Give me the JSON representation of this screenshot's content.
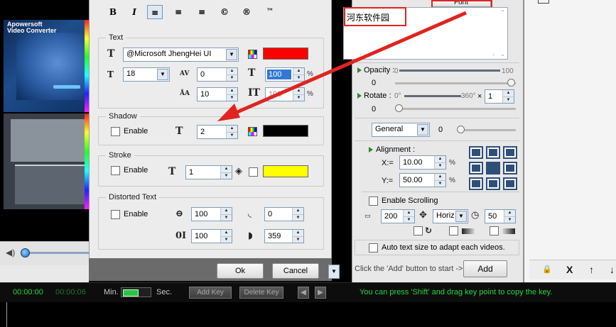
{
  "preview": {
    "brand_line1": "Apowersoft",
    "brand_line2": "Video Converter"
  },
  "dialog": {
    "toolbar": [
      "B",
      "I",
      "≡",
      "≡",
      "≡",
      "©",
      "®",
      "™"
    ],
    "text": {
      "title": "Text",
      "font": "@Microsoft JhengHei UI",
      "size": "18",
      "spacing": "0",
      "scale": "100",
      "line_height": "10",
      "opacity": "100",
      "color": "#ff0000",
      "pct": "%"
    },
    "shadow": {
      "title": "Shadow",
      "enable_label": "Enable",
      "value": "2",
      "color": "#000000"
    },
    "stroke": {
      "title": "Stroke",
      "enable_label": "Enable",
      "value": "1",
      "color": "#ffff00"
    },
    "distorted": {
      "title": "Distorted Text",
      "enable_label": "Enable",
      "width": "100",
      "height": "100",
      "angle1": "0",
      "angle2": "359"
    },
    "ok_label": "Ok",
    "cancel_label": "Cancel"
  },
  "watermark": {
    "tab_label": "Font",
    "text_content": "河东软件园",
    "opacity_label": "Opacity :",
    "opacity_min": "0",
    "opacity_max": "100",
    "opacity_value": "0",
    "rotate_label": "Rotate :",
    "rotate_min": "0°",
    "rotate_max": "360°",
    "rotate_mult": "×",
    "rotate_multiplier": "1",
    "rotate_value": "0",
    "mode_select": "General",
    "mode_value": "0",
    "alignment_label": "Alignment :",
    "x_label": "X:=",
    "x_value": "10.00",
    "y_label": "Y:=",
    "y_value": "50.00",
    "pct": "%",
    "scroll_label": "Enable Scrolling",
    "scroll_value": "200",
    "scroll_dir": "Horiz",
    "scroll_speed": "50",
    "auto_size_label": "Auto text size to adapt each videos.",
    "hint": "Click the 'Add' button to start ->",
    "add_label": "Add"
  },
  "right_tools": {
    "lock": "🔒",
    "delete": "X",
    "up": "↑",
    "down": "↓"
  },
  "timebar": {
    "current": "00:00:00",
    "total": "00:00:06",
    "min_label": "Min.",
    "sec_label": "Sec.",
    "add_key": "Add Key",
    "delete_key": "Delete Key",
    "hint": "You can press 'Shift' and drag key point to copy the key."
  },
  "colors": {
    "accent_red": "#e0241f",
    "timebar_green": "#24d53c"
  }
}
